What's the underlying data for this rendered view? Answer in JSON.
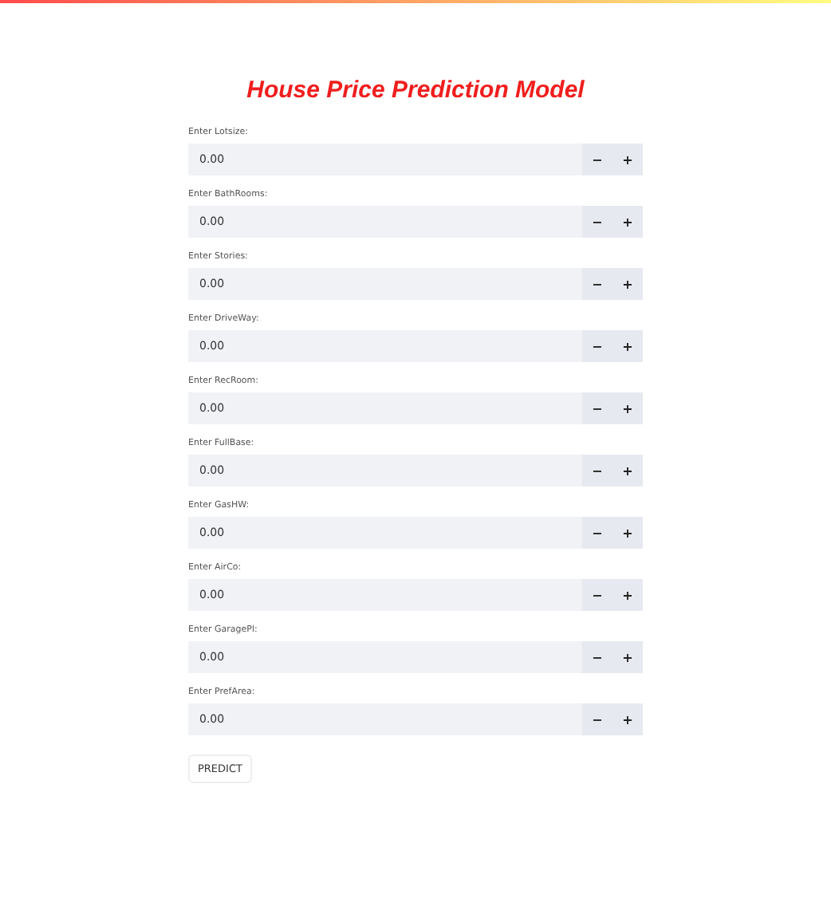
{
  "title": "House Price Prediction Model",
  "fields": [
    {
      "label": "Enter Lotsize:",
      "value": "0.00",
      "decrement": "−",
      "increment": "+"
    },
    {
      "label": "Enter BathRooms:",
      "value": "0.00",
      "decrement": "−",
      "increment": "+"
    },
    {
      "label": "Enter Stories:",
      "value": "0.00",
      "decrement": "−",
      "increment": "+"
    },
    {
      "label": "Enter DriveWay:",
      "value": "0.00",
      "decrement": "−",
      "increment": "+"
    },
    {
      "label": "Enter RecRoom:",
      "value": "0.00",
      "decrement": "−",
      "increment": "+"
    },
    {
      "label": "Enter FullBase:",
      "value": "0.00",
      "decrement": "−",
      "increment": "+"
    },
    {
      "label": "Enter GasHW:",
      "value": "0.00",
      "decrement": "−",
      "increment": "+"
    },
    {
      "label": "Enter AirCo:",
      "value": "0.00",
      "decrement": "−",
      "increment": "+"
    },
    {
      "label": "Enter GaragePl:",
      "value": "0.00",
      "decrement": "−",
      "increment": "+"
    },
    {
      "label": "Enter PrefArea:",
      "value": "0.00",
      "decrement": "−",
      "increment": "+"
    }
  ],
  "button": "PREDICT"
}
